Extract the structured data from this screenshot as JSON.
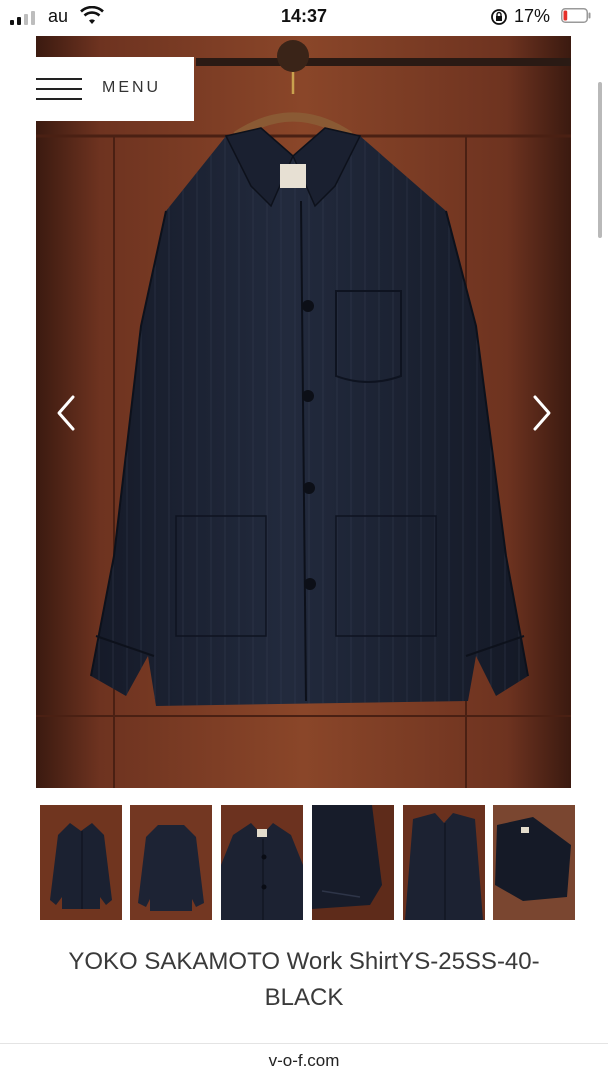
{
  "status_bar": {
    "carrier": "au",
    "time": "14:37",
    "battery_percent": "17%",
    "battery_level": 0.17,
    "signal_bars": 2,
    "signal_bars_max": 4
  },
  "menu": {
    "label": "MENU"
  },
  "slider": {
    "prev_icon": "chevron-left-icon",
    "next_icon": "chevron-right-icon",
    "thumbnail_count": 6
  },
  "product": {
    "title": "YOKO SAKAMOTO Work ShirtYS-25SS-40-BLACK"
  },
  "browser": {
    "url": "v-o-f.com"
  },
  "colors": {
    "wood": "#7a3a24",
    "jacket": "#1c2233",
    "battery_low": "#e5302a"
  }
}
